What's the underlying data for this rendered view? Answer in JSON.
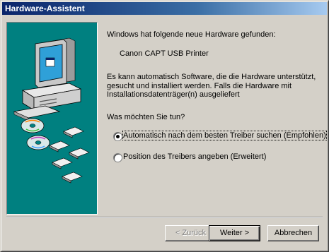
{
  "window": {
    "title": "Hardware-Assistent"
  },
  "content": {
    "found_label": "Windows hat folgende neue Hardware gefunden:",
    "device_name": "Canon CAPT USB Printer",
    "info_text": "Es kann automatisch Software, die die Hardware unterstützt, gesucht und installiert werden. Falls die Hardware mit Installationsdatenträger(n) ausgeliefert",
    "question": "Was möchten Sie tun?",
    "options": [
      {
        "label": "Automatisch nach dem besten Treiber suchen (Empfohlen)",
        "selected": true
      },
      {
        "label": "Position des Treibers angeben (Erweitert)",
        "selected": false
      }
    ]
  },
  "buttons": {
    "back": "< Zurück",
    "next": "Weiter >",
    "cancel": "Abbrechen"
  },
  "colors": {
    "titlebar_start": "#0a246a",
    "titlebar_end": "#a6caf0",
    "art_background": "#008080",
    "dialog_background": "#d4d0c8"
  },
  "icons": [
    "computer-icon",
    "cd-icon",
    "floppy-disk-icon"
  ]
}
